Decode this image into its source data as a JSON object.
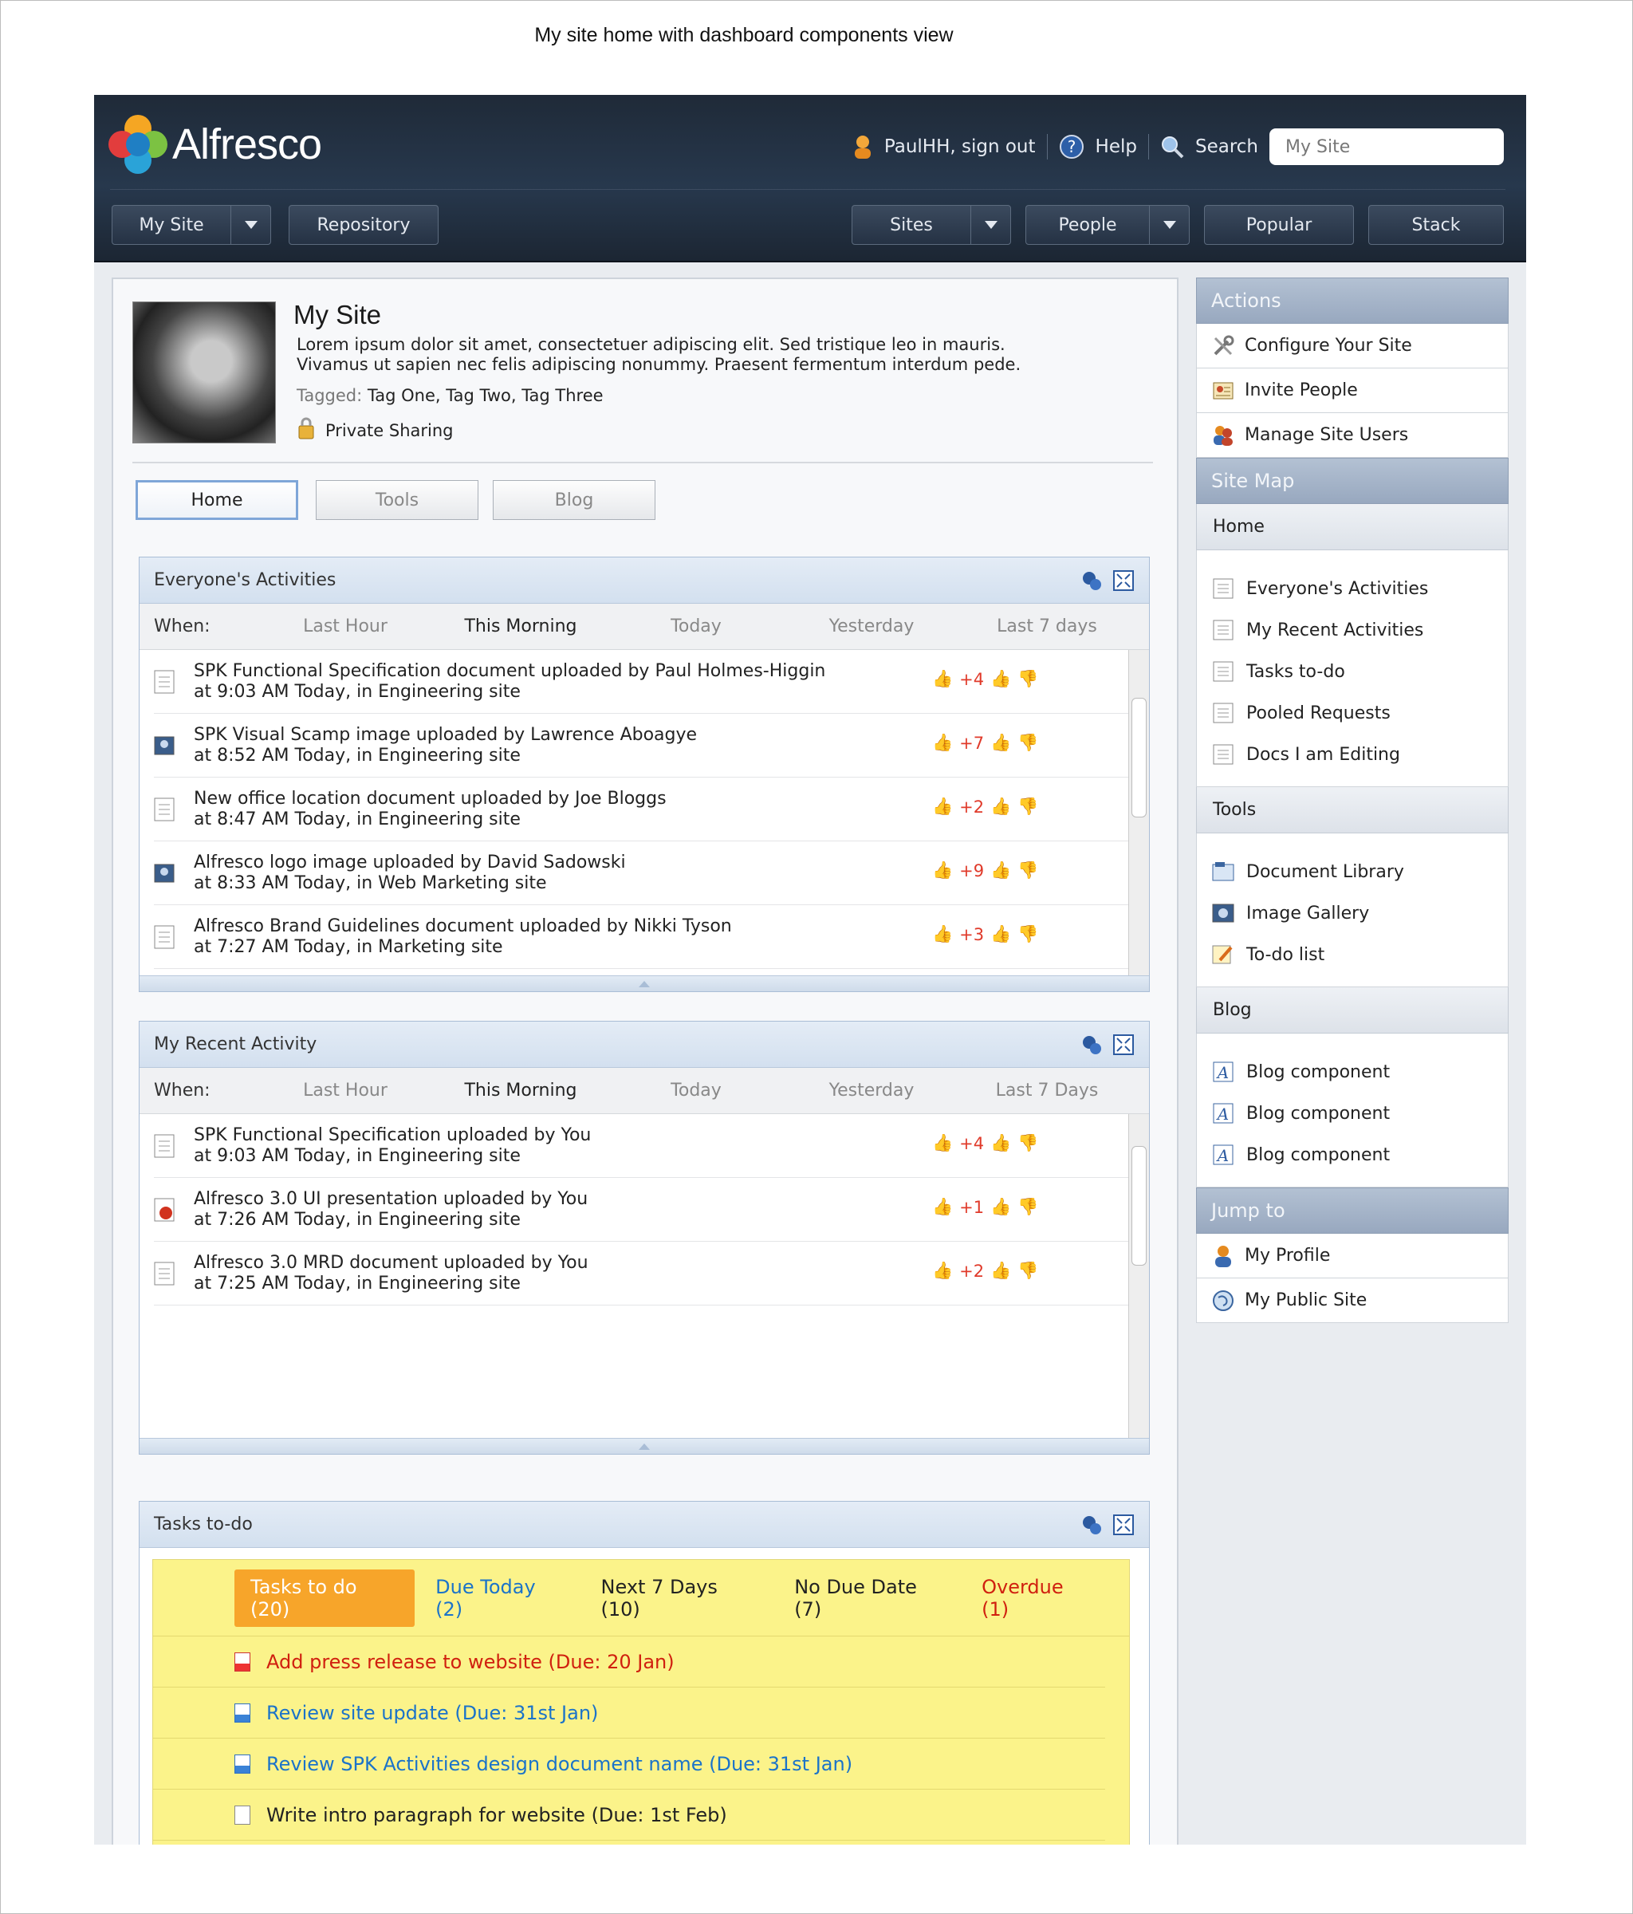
{
  "caption": "My site home with dashboard components view",
  "brand": {
    "name": "Alfresco"
  },
  "user": {
    "greeting": "PaulHH, sign out",
    "help": "Help",
    "search_label": "Search",
    "search_value": "My Site"
  },
  "nav": {
    "my_site": "My Site",
    "repository": "Repository",
    "sites": "Sites",
    "people": "People",
    "popular": "Popular",
    "stack": "Stack"
  },
  "site": {
    "title": "My Site",
    "description": "Lorem ipsum dolor sit amet, consectetuer adipiscing elit. Sed tristique leo in mauris. Vivamus ut sapien nec felis adipiscing nonummy. Praesent fermentum interdum pede.",
    "tagged_label": "Tagged:",
    "tags": "Tag One, Tag Two, Tag Three",
    "privacy": "Private Sharing"
  },
  "tabs": [
    "Home",
    "Tools",
    "Blog"
  ],
  "everyone": {
    "title": "Everyone's Activities",
    "when": "When:",
    "filters": [
      "Last Hour",
      "This Morning",
      "Today",
      "Yesterday",
      "Last 7 days"
    ],
    "items": [
      {
        "line1": "SPK Functional Specification document uploaded by Paul Holmes-Higgin",
        "line2": "at 9:03 AM Today, in Engineering site",
        "votes": "+4"
      },
      {
        "line1": "SPK Visual Scamp image uploaded by Lawrence Aboagye",
        "line2": "at 8:52 AM Today, in Engineering site",
        "votes": "+7"
      },
      {
        "line1": "New office location document uploaded by Joe Bloggs",
        "line2": "at 8:47 AM Today, in Engineering site",
        "votes": "+2"
      },
      {
        "line1": "Alfresco logo image uploaded by David Sadowski",
        "line2": "at 8:33 AM Today, in Web Marketing site",
        "votes": "+9"
      },
      {
        "line1": "Alfresco Brand Guidelines document uploaded by Nikki Tyson",
        "line2": "at 7:27 AM Today, in Marketing site",
        "votes": "+3"
      }
    ]
  },
  "recent": {
    "title": "My Recent Activity",
    "when": "When:",
    "filters": [
      "Last Hour",
      "This Morning",
      "Today",
      "Yesterday",
      "Last 7 Days"
    ],
    "items": [
      {
        "line1": "SPK Functional Specification uploaded by You",
        "line2": "at 9:03 AM Today, in Engineering site",
        "votes": "+4"
      },
      {
        "line1": "Alfresco 3.0 UI presentation uploaded by You",
        "line2": "at 7:26 AM Today, in Engineering site",
        "votes": "+1"
      },
      {
        "line1": "Alfresco 3.0 MRD document uploaded by You",
        "line2": "at 7:25 AM Today, in Engineering site",
        "votes": "+2"
      }
    ]
  },
  "tasks": {
    "title": "Tasks to-do",
    "filters": [
      "Tasks to do (20)",
      "Due Today (2)",
      "Next 7 Days (10)",
      "No Due Date (7)",
      "Overdue (1)"
    ],
    "items": [
      "Add press release to website (Due: 20 Jan)",
      "Review site update (Due: 31st Jan)",
      "Review SPK Activities design document name (Due: 31st Jan)",
      "Write intro paragraph for website (Due: 1st Feb)"
    ]
  },
  "sidebar": {
    "actions_title": "Actions",
    "actions": [
      "Configure Your Site",
      "Invite People",
      "Manage Site Users"
    ],
    "sitemap_title": "Site Map",
    "home": "Home",
    "home_items": [
      "Everyone's Activities",
      "My Recent Activities",
      "Tasks to-do",
      "Pooled Requests",
      "Docs I am Editing"
    ],
    "tools": "Tools",
    "tools_items": [
      "Document Library",
      "Image Gallery",
      "To-do list"
    ],
    "blog": "Blog",
    "blog_items": [
      "Blog component",
      "Blog component",
      "Blog component"
    ],
    "jump_title": "Jump to",
    "jump_items": [
      "My Profile",
      "My Public Site"
    ]
  },
  "colors": {
    "accent": "#1b73c9",
    "vote_red": "#e03a2a",
    "task_tab": "#f7a52a",
    "overdue": "#d0200f"
  }
}
